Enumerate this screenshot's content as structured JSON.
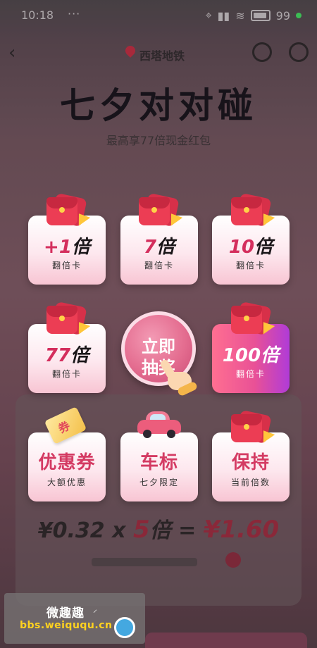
{
  "status_bar": {
    "time": "10:18",
    "dots": "···",
    "battery_percent": "99"
  },
  "nav": {
    "location": "西塔地铁"
  },
  "header": {
    "title": "七夕对对碰",
    "subtitle": "最高享77倍现金红包"
  },
  "cards": [
    {
      "prefix": "+",
      "number": "1",
      "unit": "倍",
      "label": "翻倍卡",
      "icon": "red-envelope-icon"
    },
    {
      "prefix": "",
      "number": "7",
      "unit": "倍",
      "label": "翻倍卡",
      "icon": "red-envelope-icon"
    },
    {
      "prefix": "",
      "number": "10",
      "unit": "倍",
      "label": "翻倍卡",
      "icon": "red-envelope-icon"
    },
    {
      "prefix": "",
      "number": "77",
      "unit": "倍",
      "label": "翻倍卡",
      "icon": "red-envelope-icon"
    },
    {
      "prefix": "",
      "number": "100",
      "unit": "倍",
      "label": "翻倍卡",
      "icon": "red-envelope-icon"
    },
    {
      "word": "优惠券",
      "label": "大额优惠",
      "icon": "coupon-ticket-icon",
      "icon_text": "券"
    },
    {
      "word": "车标",
      "label": "七夕限定",
      "icon": "car-icon"
    },
    {
      "word": "保持",
      "label": "当前倍数",
      "icon": "red-envelope-icon"
    }
  ],
  "start_button": {
    "line1": "立即",
    "line2": "抽奖"
  },
  "formula": {
    "base": "¥0.32",
    "times_sign": "x",
    "multiplier": "5",
    "unit": "倍",
    "equals": "=",
    "result": "¥1.60"
  },
  "watermark": {
    "title": "微趣趣",
    "url": "bbs.weiququ.cn"
  }
}
